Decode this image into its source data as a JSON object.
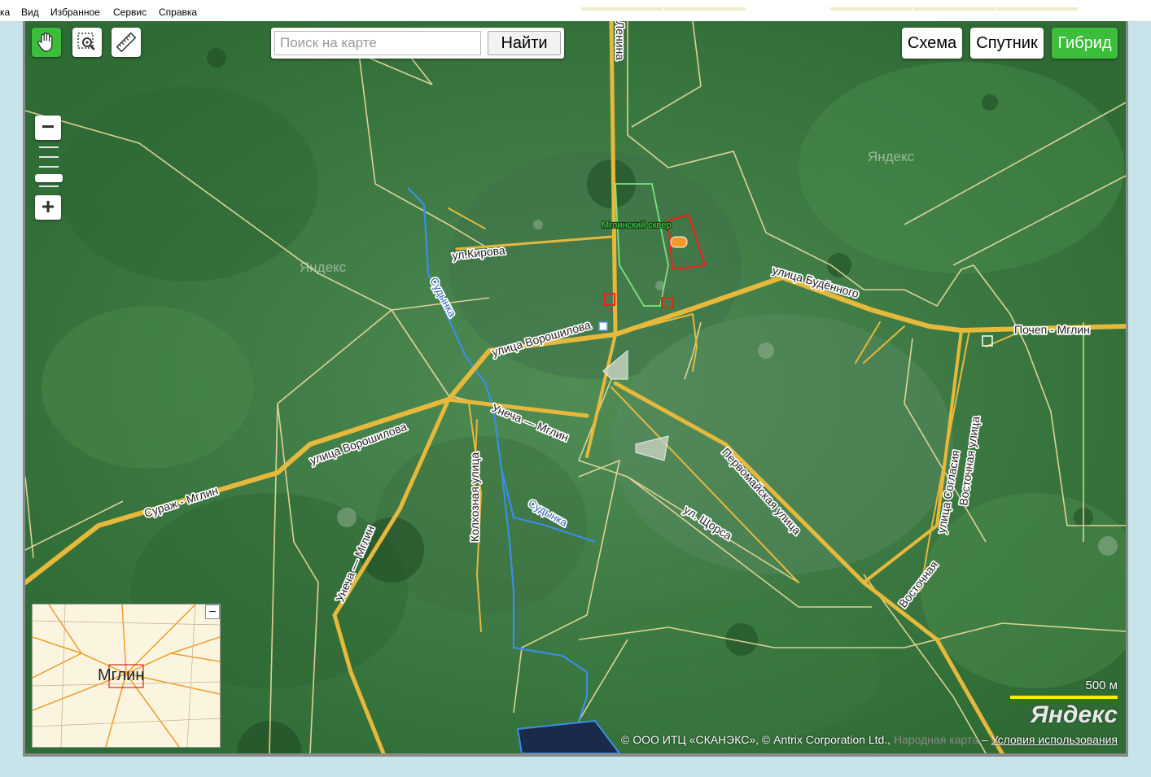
{
  "menu": [
    "ка",
    "Вид",
    "Избранное",
    "Сервис",
    "Справка"
  ],
  "search": {
    "placeholder": "Поиск на карте",
    "button": "Найти"
  },
  "layers": [
    {
      "label": "Схема",
      "active": false
    },
    {
      "label": "Спутник",
      "active": false
    },
    {
      "label": "Гибрид",
      "active": true
    }
  ],
  "tools": [
    {
      "icon": "hand-icon",
      "active": true
    },
    {
      "icon": "magnifier-zoom-icon",
      "active": false
    },
    {
      "icon": "ruler-icon",
      "active": false
    }
  ],
  "zoom": {
    "minus": "−",
    "plus": "+"
  },
  "map_labels": {
    "lenina": "Ленина",
    "kirova": "ул.Кирова",
    "sudynka1": "Судынка",
    "sudynka2": "Судынка",
    "voroshilova1": "улица Ворошилова",
    "voroshilova2": "улица Ворошилова",
    "budyonnogo": "улица Будённого",
    "pochep": "Почеп - Мглин",
    "unecha1": "Унеча — Мглин",
    "unecha2": "Унеча — Мглин",
    "surazh": "Сураж - Мглин",
    "kolkhoznaya": "Колхозная улица",
    "pervomayskaya": "Первомайская улица",
    "shchorsa": "ул. Щорса",
    "soglasiya": "улица Согласия",
    "vostochnaya1": "Восточная улица",
    "vostochnaya2": "Восточная",
    "skver": "Мглинский сквер"
  },
  "watermarks": [
    "Яндекс",
    "Яндекс"
  ],
  "minimap": {
    "label": "Мглин",
    "close": "–"
  },
  "scale": {
    "label": "500 м"
  },
  "brand": "Яндекс",
  "copyright": {
    "text": "© ООО ИТЦ «СКАНЭКС», © Antrix Corporation Ltd.,",
    "narodnaya": "Народная карта",
    "dash": "–",
    "terms": "Условия использования"
  },
  "colors": {
    "road": "#e6b83c",
    "boundary": "#f0dca0",
    "river": "#3a8ee8",
    "active": "#3cbd3c"
  }
}
